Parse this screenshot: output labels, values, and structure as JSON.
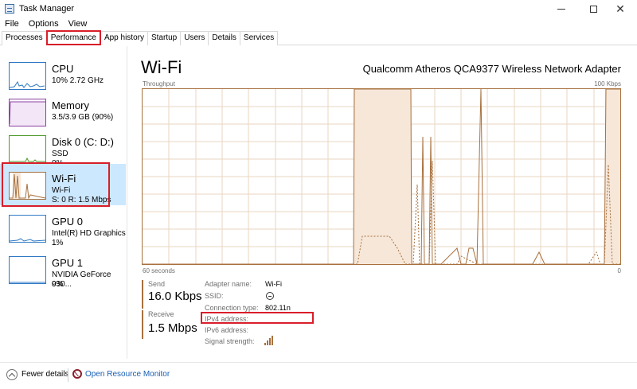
{
  "window": {
    "title": "Task Manager",
    "minimize_icon": "minimize-icon",
    "maximize_icon": "maximize-icon",
    "close_glyph": "✕"
  },
  "menu": [
    "File",
    "Options",
    "View"
  ],
  "tabs": [
    "Processes",
    "Performance",
    "App history",
    "Startup",
    "Users",
    "Details",
    "Services"
  ],
  "active_tab": "Performance",
  "resources": [
    {
      "name": "CPU",
      "line1": "10%  2.72 GHz",
      "line2": ""
    },
    {
      "name": "Memory",
      "line1": "3.5/3.9 GB (90%)",
      "line2": ""
    },
    {
      "name": "Disk 0 (C: D:)",
      "line1": "SSD",
      "line2": "0%"
    },
    {
      "name": "Wi-Fi",
      "line1": "Wi-Fi",
      "line2": "S: 0  R: 1.5 Mbps"
    },
    {
      "name": "GPU 0",
      "line1": "Intel(R) HD Graphics ...",
      "line2": "1%"
    },
    {
      "name": "GPU 1",
      "line1": "NVIDIA GeForce 930...",
      "line2": "0%"
    }
  ],
  "selected_resource": "Wi-Fi",
  "main": {
    "title": "Wi-Fi",
    "adapter": "Qualcomm Atheros QCA9377 Wireless Network Adapter",
    "graph_label": "Throughput",
    "graph_max": "100 Kbps",
    "graph_time": "60 seconds",
    "graph_min": "0"
  },
  "stats": {
    "send_label": "Send",
    "send_value": "16.0 Kbps",
    "receive_label": "Receive",
    "receive_value": "1.5 Mbps"
  },
  "details": [
    {
      "label": "Adapter name:",
      "value": "Wi-Fi"
    },
    {
      "label": "SSID:",
      "value": ""
    },
    {
      "label": "Connection type:",
      "value": "802.11n"
    },
    {
      "label": "IPv4 address:",
      "value": ""
    },
    {
      "label": "IPv6 address:",
      "value": ""
    },
    {
      "label": "Signal strength:",
      "value": ""
    }
  ],
  "footer": {
    "fewer_details": "Fewer details",
    "open_monitor": "Open Resource Monitor"
  },
  "colors": {
    "accent_network": "#a7703d",
    "highlight_red": "#d91e2a",
    "selection_bg": "#cce8ff",
    "link_blue": "#1a5fb4"
  }
}
